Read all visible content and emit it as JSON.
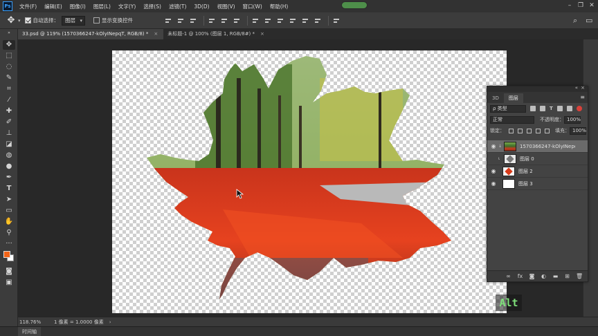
{
  "menubar": {
    "logo": "Ps",
    "items": [
      "文件(F)",
      "编辑(E)",
      "图像(I)",
      "图层(L)",
      "文字(Y)",
      "选择(S)",
      "滤镜(T)",
      "3D(D)",
      "视图(V)",
      "窗口(W)",
      "帮助(H)"
    ]
  },
  "options": {
    "auto_select_label": "自动选择：",
    "auto_select_value": "图层",
    "show_transform_label": "显示变换控件"
  },
  "tabs": [
    {
      "label": "33.psd @ 119% (1570366247-kOlyINepqT, RGB/8) *",
      "close": "×"
    },
    {
      "label": "未标题-1 @ 100% (图层 1, RGB/8#) *",
      "close": "×"
    }
  ],
  "status": {
    "zoom": "118.76%",
    "doc_info": "1 像素 = 1.0000 像素",
    "arrow": "›"
  },
  "timeline": {
    "tab": "时间轴"
  },
  "layers_panel": {
    "tab_3d": "3D",
    "tab_layers": "图层",
    "filter_kind": "ρ 类型",
    "blend_mode": "正常",
    "opacity_label": "不透明度：",
    "opacity_value": "100%",
    "lock_label": "锁定：",
    "fill_label": "填充：",
    "fill_value": "100%",
    "layers": [
      {
        "name": "1570366247-kOlyINepq...",
        "thumb": "photo",
        "visible": true,
        "selected": true
      },
      {
        "name": "图层 0",
        "thumb": "leafmask",
        "visible": false,
        "selected": false
      },
      {
        "name": "图层 2",
        "thumb": "leaf-red",
        "visible": true,
        "selected": false
      },
      {
        "name": "图层 3",
        "thumb": "white",
        "visible": true,
        "selected": false
      }
    ]
  },
  "overlay": {
    "key_indicator": "Alt"
  },
  "colors": {
    "foreground": "#f26418",
    "background": "#ffffff",
    "accent": "#7ee07a"
  }
}
